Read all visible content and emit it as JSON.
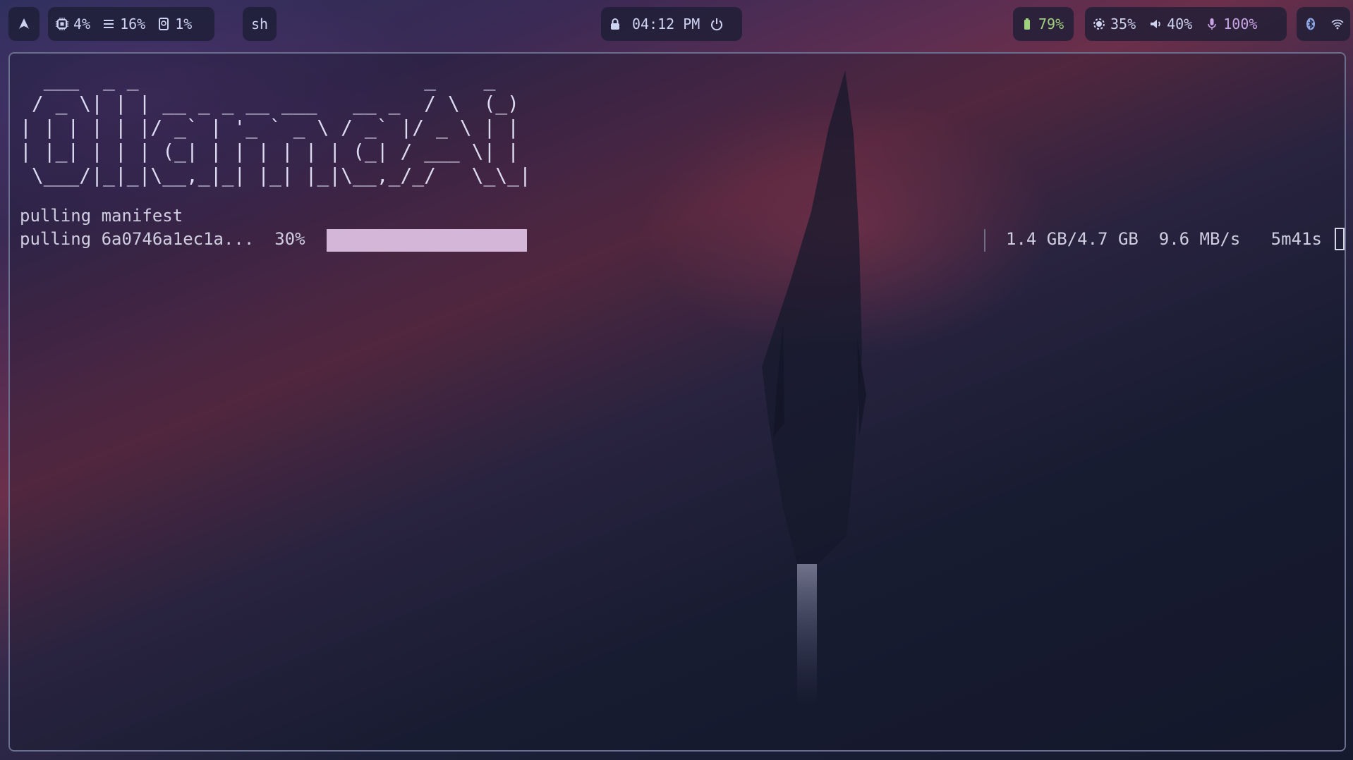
{
  "topbar": {
    "launcher_icon": "arch-logo-icon",
    "cpu": "4%",
    "memory": "16%",
    "disk": "1%",
    "shell": "sh",
    "clock": "04:12 PM",
    "battery": "79%",
    "brightness": "35%",
    "volume": "40%",
    "microphone": "100%",
    "colors": {
      "battery": "#9fd17e",
      "microphone": "#c8a3e6",
      "bar": "#1c1e34"
    }
  },
  "terminal": {
    "ascii_banner": "  ___  _ _                        _    _ \n / _ \\| | | __ _ _ __ ___   __ _  / \\  (_)\n| | | | | |/ _` | '_ ` _ \\ / _` |/ _ \\ | |\n| |_| | | | (_| | | | | | | (_| / ___ \\| |\n \\___/|_|_|\\__,_|_| |_| |_|\\__,_/_/   \\_\\_|",
    "line1": "pulling manifest",
    "line2_prefix": "pulling 6a0746a1ec1a...  30%",
    "progress": 0.3,
    "progress_text": "1.4 GB/4.7 GB  9.6 MB/s   5m41s",
    "progress_color": "#d3b6d8"
  }
}
